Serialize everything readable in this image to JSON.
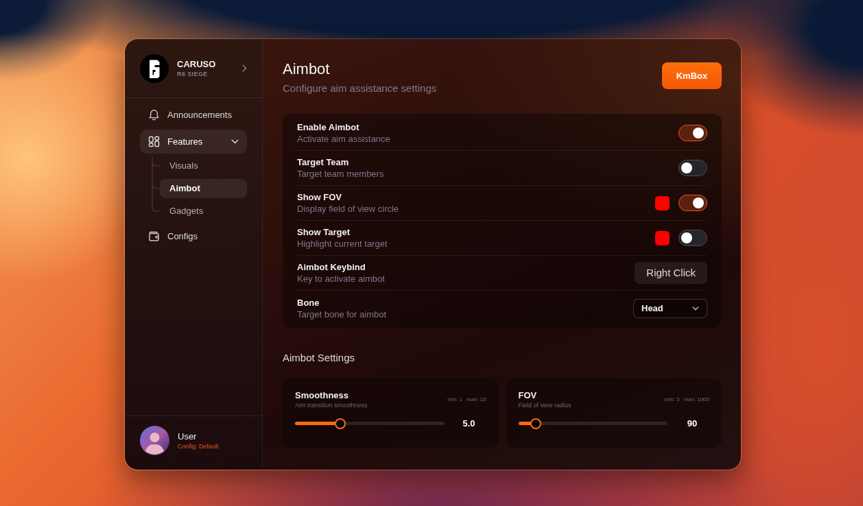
{
  "brand": {
    "name": "CARUSO",
    "subtitle": "R6 SIEGE"
  },
  "sidebar": {
    "items": [
      {
        "label": "Announcements",
        "selected": false
      },
      {
        "label": "Features",
        "selected": true,
        "expanded": true,
        "children": [
          {
            "label": "Visuals",
            "selected": false
          },
          {
            "label": "Aimbot",
            "selected": true
          },
          {
            "label": "Gadgets",
            "selected": false
          }
        ]
      },
      {
        "label": "Configs",
        "selected": false
      }
    ]
  },
  "user": {
    "name": "User",
    "config": "Config: Default"
  },
  "page": {
    "title": "Aimbot",
    "subtitle": "Configure aim assistance settings",
    "action": "KmBox"
  },
  "settings": [
    {
      "kind": "toggle",
      "title": "Enable Aimbot",
      "description": "Activate aim assistance",
      "on": true
    },
    {
      "kind": "toggle",
      "title": "Target Team",
      "description": "Target team members",
      "on": false
    },
    {
      "kind": "toggle",
      "title": "Show FOV",
      "description": "Display field of view circle",
      "on": true,
      "color": "#ff0000"
    },
    {
      "kind": "toggle",
      "title": "Show Target",
      "description": "Highlight current target",
      "on": false,
      "color": "#ff0000"
    },
    {
      "kind": "keybind",
      "title": "Aimbot Keybind",
      "description": "Key to activate aimbot",
      "value": "Right Click"
    },
    {
      "kind": "select",
      "title": "Bone",
      "description": "Target bone for aimbot",
      "value": "Head"
    }
  ],
  "section_title": "Aimbot Settings",
  "sliders": [
    {
      "title": "Smoothness",
      "description": "Aim transition smoothness",
      "min": "min: 1",
      "max": "max: 15",
      "level": 0.29,
      "reading": "5.0"
    },
    {
      "title": "FOV",
      "description": "Field of view radius",
      "min": "min: 5",
      "max": "max: 1000",
      "level": 0.085,
      "reading": "90"
    }
  ]
}
